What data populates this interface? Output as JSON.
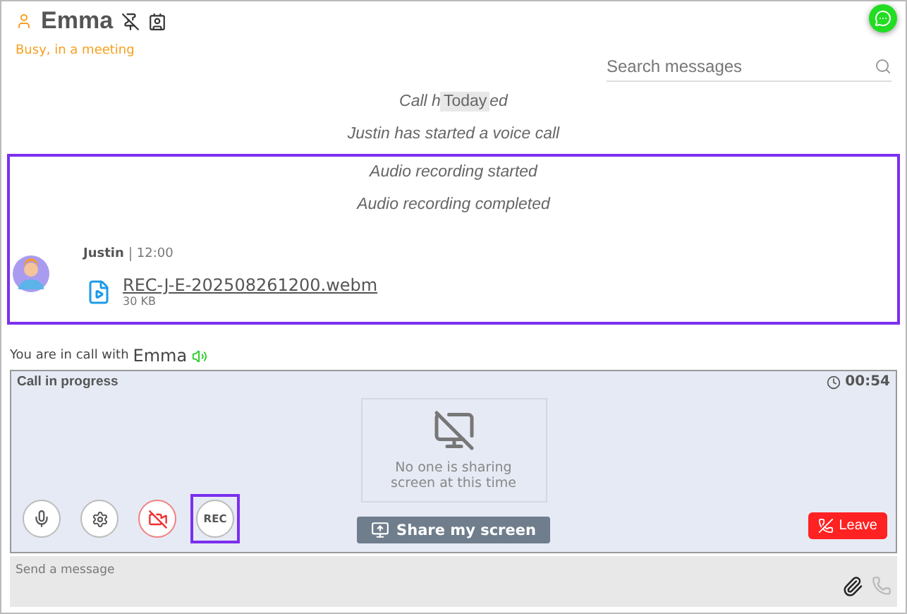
{
  "contact": {
    "name": "Emma",
    "status": "Busy, in a meeting"
  },
  "search": {
    "placeholder": "Search messages"
  },
  "day_badge": "Today",
  "events": [
    {
      "kind": "split",
      "before": "Call h",
      "after": "ed",
      "highlighted": false
    },
    {
      "kind": "system",
      "text": "Justin has started a voice call",
      "highlighted": false
    },
    {
      "kind": "system",
      "text": "Audio recording started",
      "highlighted": true
    },
    {
      "kind": "system",
      "text": "Audio recording completed",
      "highlighted": true
    },
    {
      "kind": "file",
      "sender": "Justin",
      "time": "12:00",
      "file_name": "REC-J-E-202508261200.webm",
      "file_size": "30 KB",
      "highlighted": true
    }
  ],
  "call_banner": {
    "prefix": "You are in call with",
    "name": "Emma"
  },
  "call": {
    "title": "Call in progress",
    "timer": "00:54",
    "share_note": "No one is sharing screen at this time",
    "share_button": "Share my screen",
    "leave_button": "Leave",
    "controls": [
      {
        "kind": "mic",
        "off": false,
        "highlighted": false
      },
      {
        "kind": "settings",
        "off": false,
        "highlighted": false
      },
      {
        "kind": "camera",
        "off": true,
        "highlighted": false
      },
      {
        "kind": "rec",
        "label": "REC",
        "off": false,
        "highlighted": true
      }
    ]
  },
  "composer": {
    "placeholder": "Send a message"
  }
}
